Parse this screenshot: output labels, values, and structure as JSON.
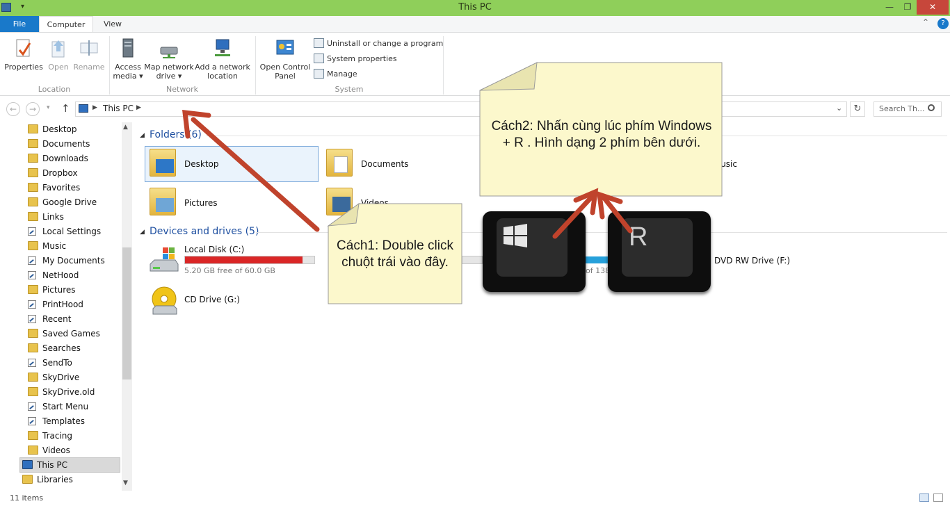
{
  "window": {
    "title": "This PC",
    "minimize": "—",
    "maximize": "❐",
    "close": "✕"
  },
  "tabs": {
    "file": "File",
    "computer": "Computer",
    "view": "View",
    "collapse": "⌃",
    "help": "?"
  },
  "ribbon": {
    "location": {
      "label": "Location",
      "properties": "Properties",
      "open": "Open",
      "rename": "Rename"
    },
    "network": {
      "label": "Network",
      "access_media_1": "Access",
      "access_media_2": "media",
      "map_drive_1": "Map network",
      "map_drive_2": "drive",
      "add_location_1": "Add a network",
      "add_location_2": "location"
    },
    "system": {
      "label": "System",
      "control_panel_1": "Open Control",
      "control_panel_2": "Panel",
      "uninstall": "Uninstall or change a program",
      "system_properties": "System properties",
      "manage": "Manage"
    }
  },
  "address": {
    "path": "This PC",
    "search_placeholder": "Search Th..."
  },
  "sidebar": {
    "items": [
      {
        "label": "Desktop",
        "icon": "folder-icon"
      },
      {
        "label": "Documents",
        "icon": "folder-icon"
      },
      {
        "label": "Downloads",
        "icon": "folder-icon"
      },
      {
        "label": "Dropbox",
        "icon": "folder-icon"
      },
      {
        "label": "Favorites",
        "icon": "folder-icon"
      },
      {
        "label": "Google Drive",
        "icon": "folder-icon"
      },
      {
        "label": "Links",
        "icon": "folder-icon"
      },
      {
        "label": "Local Settings",
        "icon": "link-icon"
      },
      {
        "label": "Music",
        "icon": "folder-icon"
      },
      {
        "label": "My Documents",
        "icon": "link-icon"
      },
      {
        "label": "NetHood",
        "icon": "link-icon"
      },
      {
        "label": "Pictures",
        "icon": "folder-icon"
      },
      {
        "label": "PrintHood",
        "icon": "link-icon"
      },
      {
        "label": "Recent",
        "icon": "link-icon"
      },
      {
        "label": "Saved Games",
        "icon": "folder-icon"
      },
      {
        "label": "Searches",
        "icon": "folder-icon"
      },
      {
        "label": "SendTo",
        "icon": "link-icon"
      },
      {
        "label": "SkyDrive",
        "icon": "folder-icon"
      },
      {
        "label": "SkyDrive.old",
        "icon": "folder-icon"
      },
      {
        "label": "Start Menu",
        "icon": "link-icon"
      },
      {
        "label": "Templates",
        "icon": "link-icon"
      },
      {
        "label": "Tracing",
        "icon": "folder-icon"
      },
      {
        "label": "Videos",
        "icon": "folder-icon"
      }
    ],
    "this_pc": "This PC",
    "libraries": "Libraries"
  },
  "content": {
    "folders_header": "Folders (6)",
    "folders": [
      "Desktop",
      "Documents",
      "Pictures",
      "Videos",
      "Music"
    ],
    "drives_header": "Devices and drives (5)",
    "drives": [
      {
        "name": "Local Disk (C:)",
        "free": "5.20 GB free of 60.0 GB",
        "used_fraction": 0.91
      },
      {
        "name": "CD Drive (G:)"
      },
      {
        "name": "DVD RW Drive (F:)"
      }
    ],
    "partial_free": "of 138"
  },
  "notes": {
    "note1": "Cách1: Double click chuột trái vào đây.",
    "note2": "Cách2: Nhấn cùng lúc phím Windows + R . Hình dạng 2 phím bên dưới.",
    "key_r": "R"
  },
  "status": {
    "items": "11 items"
  },
  "colors": {
    "titlebar": "#8fcf5a",
    "file_tab": "#1979ca",
    "arrow": "#c0432c",
    "note_bg": "#fcf8cc"
  }
}
